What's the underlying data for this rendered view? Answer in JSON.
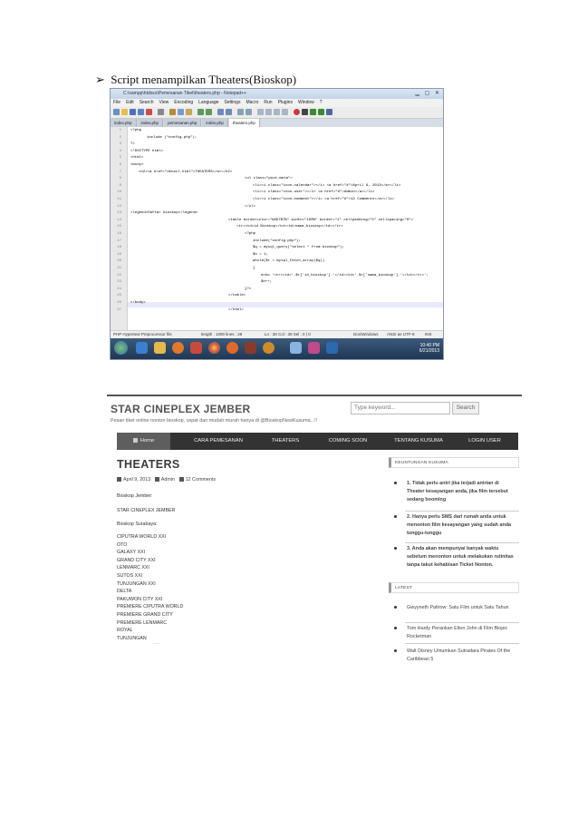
{
  "heading": {
    "bullet": "➢",
    "text": "Script menampilkan Theaters(Bioskop)"
  },
  "editor": {
    "title": "C:\\xampp\\htdocs\\Pemesanan Tiket\\theaters.php - Notepad++",
    "window_buttons": "▁ ▢ ✕",
    "menu": [
      "File",
      "Edit",
      "Search",
      "View",
      "Encoding",
      "Language",
      "Settings",
      "Macro",
      "Run",
      "Plugins",
      "Window",
      "?"
    ],
    "tabs": [
      "index.php",
      "index.php",
      "pemesanan.php",
      "index.php",
      "theaters.php"
    ],
    "code_lines": [
      {
        "n": "1",
        "indent": 0,
        "text": "<?php"
      },
      {
        "n": "2",
        "indent": 2,
        "text": "include (\"config.php\");"
      },
      {
        "n": "3",
        "indent": 0,
        "text": "?>"
      },
      {
        "n": "4",
        "indent": 0,
        "text": "<!DOCTYPE html>"
      },
      {
        "n": "5",
        "indent": 0,
        "text": "<html>"
      },
      {
        "n": "6",
        "indent": 0,
        "text": "<body>"
      },
      {
        "n": "7",
        "indent": 1,
        "text": "<h2><a href=\"detail.html\">THEATERS</a></h2>"
      },
      {
        "n": "8",
        "indent": 14,
        "text": "<ul class=\"post-meta\">"
      },
      {
        "n": "9",
        "indent": 15,
        "text": "<li><i class=\"icon-calendar\"></i> <a href=\"#\">April 9, 2013</a></li>"
      },
      {
        "n": "10",
        "indent": 15,
        "text": "<li><i class=\"icon-user\"></i> <a href=\"#\">Admin</a></li>"
      },
      {
        "n": "11",
        "indent": 15,
        "text": "<li><i class=\"icon-comment\"></i> <a href=\"#\">12 Comments</a></li>"
      },
      {
        "n": "12",
        "indent": 14,
        "text": "</ul>"
      },
      {
        "n": "13",
        "indent": 0,
        "text": "<legend>Daftar bioskop</legend>"
      },
      {
        "n": "14",
        "indent": 12,
        "text": "<table bordercolor=\"#8D7B7B\" width=\"100%\" border=\"1\" cellpadding=\"5\" cellspacing=\"0\">"
      },
      {
        "n": "15",
        "indent": 13,
        "text": "<tr><td>id Bioskop</td><td>nama_bioskop</td></tr>"
      },
      {
        "n": "16",
        "indent": 14,
        "text": "<?php"
      },
      {
        "n": "17",
        "indent": 15,
        "text": "include(\"config.php\");"
      },
      {
        "n": "18",
        "indent": 15,
        "text": "$q = mysql_query(\"select * from bioskop\");"
      },
      {
        "n": "19",
        "indent": 15,
        "text": "$n = 1;"
      },
      {
        "n": "20",
        "indent": 15,
        "text": "while($r = mysql_fetch_array($q))"
      },
      {
        "n": "21",
        "indent": 15,
        "text": "{"
      },
      {
        "n": "22",
        "indent": 16,
        "text": "echo '<tr><td>'.$r['id_bioskop'].'</td><td>'.$r['nama_bioskop'].'</td></tr>';"
      },
      {
        "n": "23",
        "indent": 16,
        "text": "$n++;"
      },
      {
        "n": "24",
        "indent": 14,
        "text": "}?>"
      },
      {
        "n": "25",
        "indent": 12,
        "text": "</table>"
      },
      {
        "n": "26",
        "indent": 0,
        "text": "</body>"
      },
      {
        "n": "27",
        "indent": 12,
        "text": "</html>"
      }
    ],
    "status": {
      "filetype": "PHP Hypertext Preprocessor file",
      "length": "length : 1090   lines : 28",
      "position": "Ln : 28   Col : 39   Sel : 0 | 0",
      "eol": "Dos\\Windows",
      "encoding": "ANSI as UTF-8",
      "mode": "INS"
    },
    "clock": {
      "time": "10:40 PM",
      "date": "6/21/2013"
    }
  },
  "site": {
    "title": "STAR CINEPLEX JEMBER",
    "tagline": "Pesan tiket online nonton bioskop, cepat dan mudah murah hanya di @BioskopNewKusuma...!!",
    "search_placeholder": "Type keyword...",
    "search_button": "Search",
    "nav": [
      "Home",
      "CARA PEMESANAN",
      "THEATERS",
      "COMING SOON",
      "TENTANG KUSUMA",
      "LOGIN USER"
    ],
    "page_title": "THEATERS",
    "meta": {
      "date": "April 9, 2013",
      "author": "Admin",
      "comments": "12 Comments"
    },
    "content_intro": [
      "Bioskop Jember:",
      "STAR CINEPLEX JEMBER",
      "Bioskop Surabaya:"
    ],
    "cinemas": [
      "CIPUTRA WORLD XXI",
      "OTO",
      "GALAXY XXI",
      "GRAND CITY XXI",
      "LENMARC XXI",
      "SUTOS XXI",
      "TUNJUNGAN XXI",
      "DELTA",
      "PAKUWON CITY XXI",
      "PREMIERE CIPUTRA WORLD",
      "PREMIERE GRAND CITY",
      "PREMIERE LENMARC",
      "ROYAL",
      "TUNJUNGAN"
    ],
    "footer_small": "——",
    "sidebar": {
      "section1": "KEUNTUNGAN KUSUMA",
      "benefits": [
        "1. Tidak perlu antri jika terjadi antrian di Theater kesayangan anda, jika film tersebut sedang booming",
        "2. Hanya perlu SMS dari rumah anda untuk menonton film kesayangan yang sudah anda tunggu-tunggu",
        "3. Anda akan mempunyai banyak waktu sebelum menonton untuk melakukan rutinitas tanpa takut kehabisan Ticket Nonton."
      ],
      "section2": "LATEST",
      "latest": [
        "Gwyyneth Paltrow: Satu Film untuk Satu Tahun",
        "Tom Hardy Perankan Elton John di Film Biopic Rocketman",
        "Walt Disney Umumkan Sutradara Pirates Of the Caribbean 5"
      ]
    }
  }
}
